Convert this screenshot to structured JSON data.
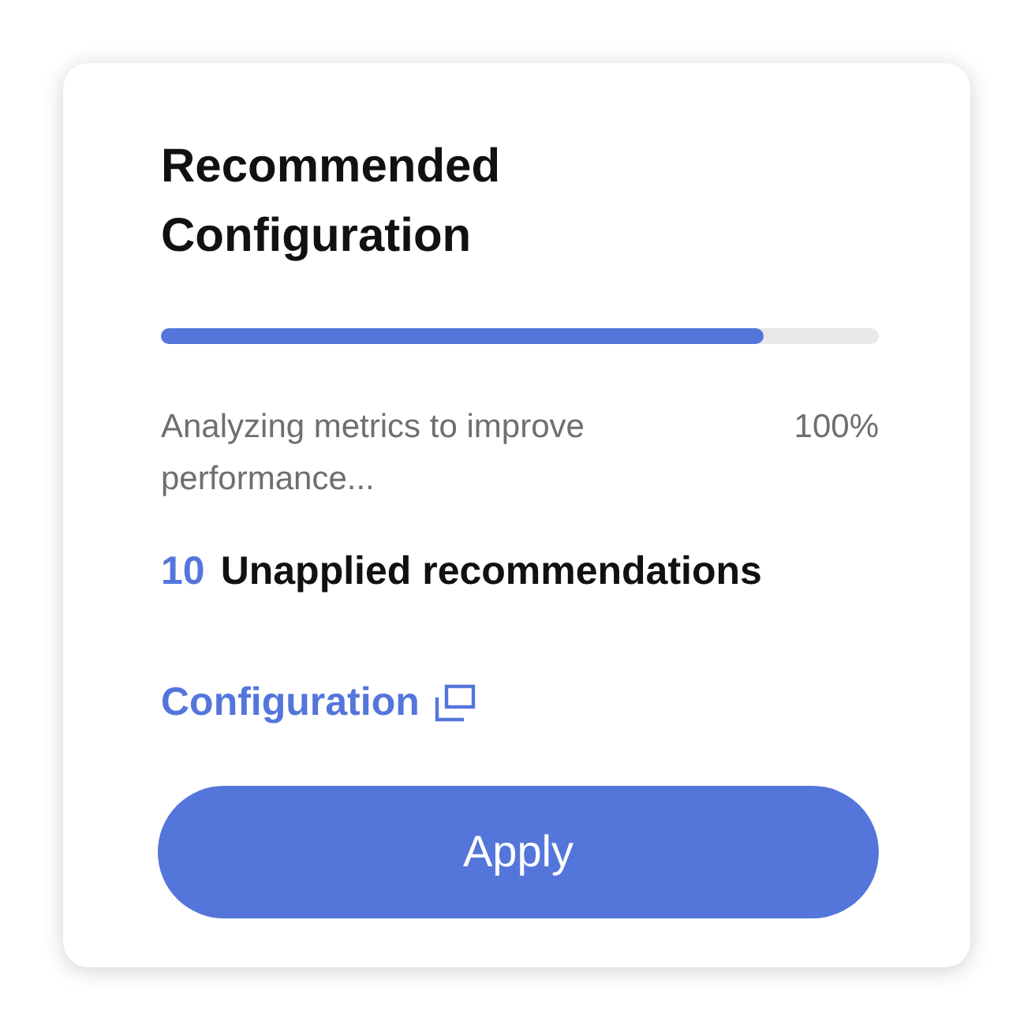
{
  "card": {
    "title": "Recommended Configuration",
    "progress": {
      "level": 0.84,
      "status": "Analyzing metrics to improve performance...",
      "percent": "100%"
    },
    "recommendations": {
      "count": "10",
      "label": "Unapplied recommendations"
    },
    "link": {
      "label": "Configuration"
    },
    "button": {
      "label": "Apply"
    }
  }
}
